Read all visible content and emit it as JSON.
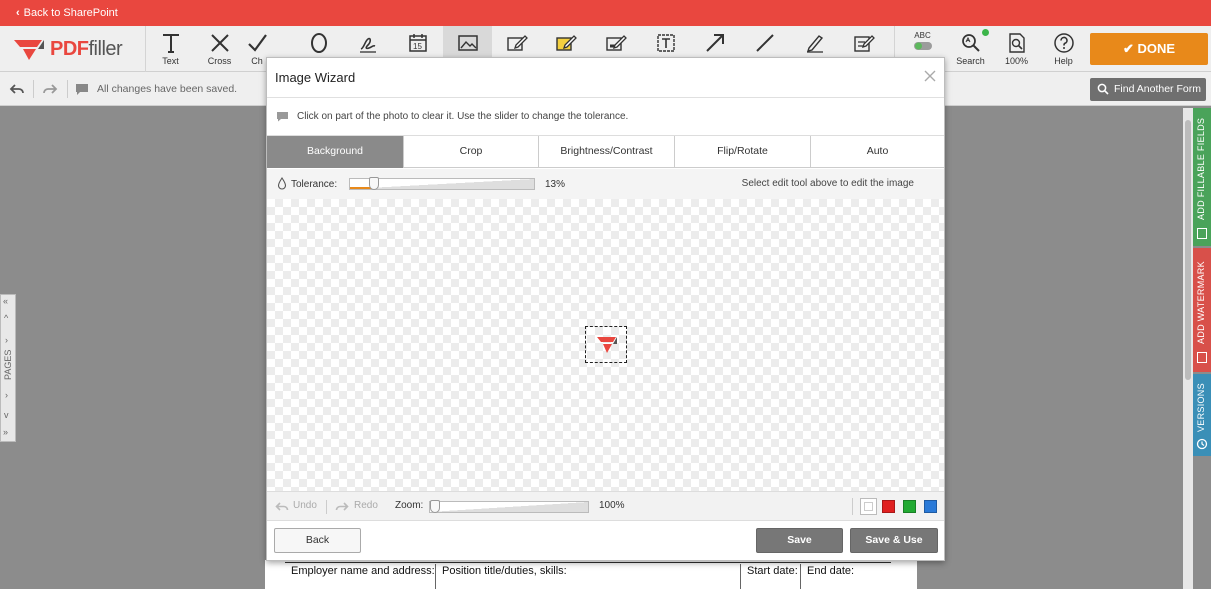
{
  "topbar": {
    "back_label": "Back to SharePoint"
  },
  "logo": {
    "text_pdf": "PDF",
    "text_filler": "filler"
  },
  "tools": [
    {
      "label": "Text",
      "icon": "text-icon"
    },
    {
      "label": "Cross",
      "icon": "cross-icon"
    },
    {
      "label": "Ch",
      "icon": "check-icon"
    },
    {
      "label": "",
      "icon": "circle-icon"
    },
    {
      "label": "",
      "icon": "signature-icon"
    },
    {
      "label": "",
      "icon": "date-icon"
    },
    {
      "label": "",
      "icon": "image-icon"
    },
    {
      "label": "",
      "icon": "erase-icon"
    },
    {
      "label": "",
      "icon": "highlight-icon"
    },
    {
      "label": "",
      "icon": "blackout-icon"
    },
    {
      "label": "",
      "icon": "textbox-icon"
    },
    {
      "label": "",
      "icon": "arrow-icon"
    },
    {
      "label": "",
      "icon": "line-icon"
    },
    {
      "label": "",
      "icon": "draw-icon"
    },
    {
      "label": "",
      "icon": "sticky-note-icon"
    }
  ],
  "right_tools": {
    "spell": "ABC",
    "search": "Search",
    "zoom": "100%",
    "help": "Help"
  },
  "done_label": "DONE",
  "subbar": {
    "saved_text": "All changes have been saved.",
    "find_form": "Find Another Form"
  },
  "pages_label": "PAGES",
  "right_tabs": {
    "fillable": "ADD FILLABLE FIELDS",
    "watermark": "ADD WATERMARK",
    "versions": "VERSIONS"
  },
  "document": {
    "cells": [
      "Employer name and address:",
      "Position title/duties, skills:",
      "Start date:",
      "End date:"
    ]
  },
  "modal": {
    "title": "Image Wizard",
    "hint": "Click on part of the photo to clear it. Use the slider to change the tolerance.",
    "tabs": [
      "Background",
      "Crop",
      "Brightness/Contrast",
      "Flip/Rotate",
      "Auto"
    ],
    "tolerance_label": "Tolerance:",
    "tolerance_percent": "13%",
    "tolerance_value": 0.13,
    "tolerance_note": "Select edit tool above to edit the image",
    "undo": "Undo",
    "redo": "Redo",
    "zoom_label": "Zoom:",
    "zoom_percent": "100%",
    "zoom_value": 0.0,
    "swatches": [
      "#ffffff",
      "#e02020",
      "#22aa33",
      "#2a7ad8"
    ],
    "back": "Back",
    "save": "Save",
    "save_use": "Save & Use"
  },
  "colors": {
    "brand_red": "#e9473f",
    "done_orange": "#e8891a",
    "tab_green": "#4aa35a",
    "tab_red": "#d8504a",
    "tab_blue": "#3a8fb7"
  }
}
